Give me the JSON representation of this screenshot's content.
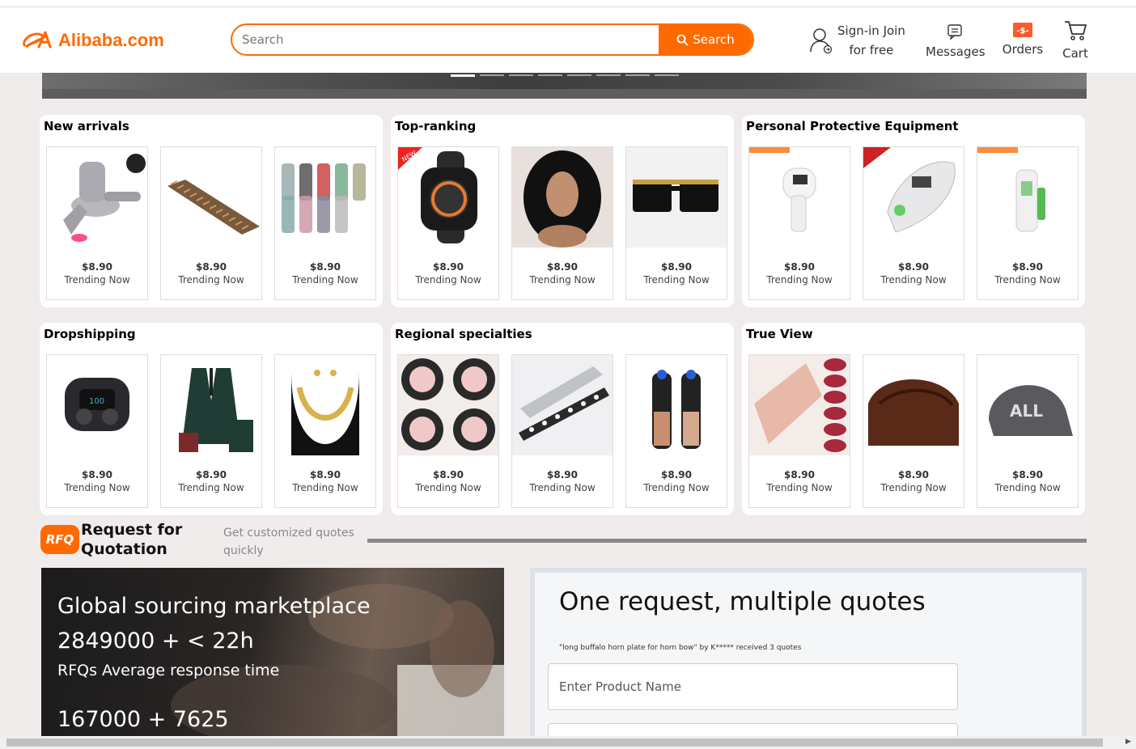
{
  "header": {
    "logo_text": "Alibaba.com",
    "search_placeholder": "Search",
    "search_button": "Search",
    "signin_line1": "Sign-in Join",
    "signin_line2": "for free",
    "messages": "Messages",
    "orders": "Orders",
    "cart": "Cart",
    "accent_color": "#ff6a00"
  },
  "banner": {
    "slides": 8,
    "active_slide": 1
  },
  "sections": [
    {
      "title": "New arrivals",
      "items": [
        {
          "price": "$8.90",
          "tag": "Trending Now",
          "icon": "tracksuit-image"
        },
        {
          "price": "$8.90",
          "tag": "Trending Now",
          "icon": "wood-panel-image"
        },
        {
          "price": "$8.90",
          "tag": "Trending Now",
          "icon": "tumblers-image"
        }
      ]
    },
    {
      "title": "Top-ranking",
      "items": [
        {
          "price": "$8.90",
          "tag": "Trending Now",
          "icon": "smartwatch-image"
        },
        {
          "price": "$8.90",
          "tag": "Trending Now",
          "icon": "wig-image"
        },
        {
          "price": "$8.90",
          "tag": "Trending Now",
          "icon": "sunglasses-image"
        }
      ]
    },
    {
      "title": "Personal Protective Equipment",
      "items": [
        {
          "price": "$8.90",
          "tag": "Trending Now",
          "icon": "thermometer-gun-image"
        },
        {
          "price": "$8.90",
          "tag": "Trending Now",
          "icon": "ear-thermometer-image"
        },
        {
          "price": "$8.90",
          "tag": "Trending Now",
          "icon": "forehead-thermometer-image"
        }
      ]
    },
    {
      "title": "Dropshipping",
      "items": [
        {
          "price": "$8.90",
          "tag": "Trending Now",
          "icon": "earbuds-image"
        },
        {
          "price": "$8.90",
          "tag": "Trending Now",
          "icon": "suit-image"
        },
        {
          "price": "$8.90",
          "tag": "Trending Now",
          "icon": "necklace-image"
        }
      ]
    },
    {
      "title": "Regional specialties",
      "items": [
        {
          "price": "$8.90",
          "tag": "Trending Now",
          "icon": "eyelashes-image"
        },
        {
          "price": "$8.90",
          "tag": "Trending Now",
          "icon": "tile-trim-image"
        },
        {
          "price": "$8.90",
          "tag": "Trending Now",
          "icon": "pepper-grinder-image"
        }
      ]
    },
    {
      "title": "True View",
      "items": [
        {
          "price": "$8.90",
          "tag": "Trending Now",
          "icon": "lipstick-set-image"
        },
        {
          "price": "$8.90",
          "tag": "Trending Now",
          "icon": "hair-piece-image"
        },
        {
          "price": "$8.90",
          "tag": "Trending Now",
          "icon": "cap-image"
        }
      ]
    }
  ],
  "rfq": {
    "logo": "RFQ",
    "title_line1": "Request for",
    "title_line2": "Quotation",
    "subtitle": "Get customized quotes quickly"
  },
  "sourcing": {
    "line1": "Global sourcing marketplace",
    "line2": "2849000 + < 22h",
    "line3": "RFQs Average response time",
    "line4": "167000 + 7625"
  },
  "quote_form": {
    "title": "One request, multiple quotes",
    "example": "\"long buffalo horn plate for horn bow\" by K***** received 3 quotes",
    "product_placeholder": "Enter Product Name"
  }
}
